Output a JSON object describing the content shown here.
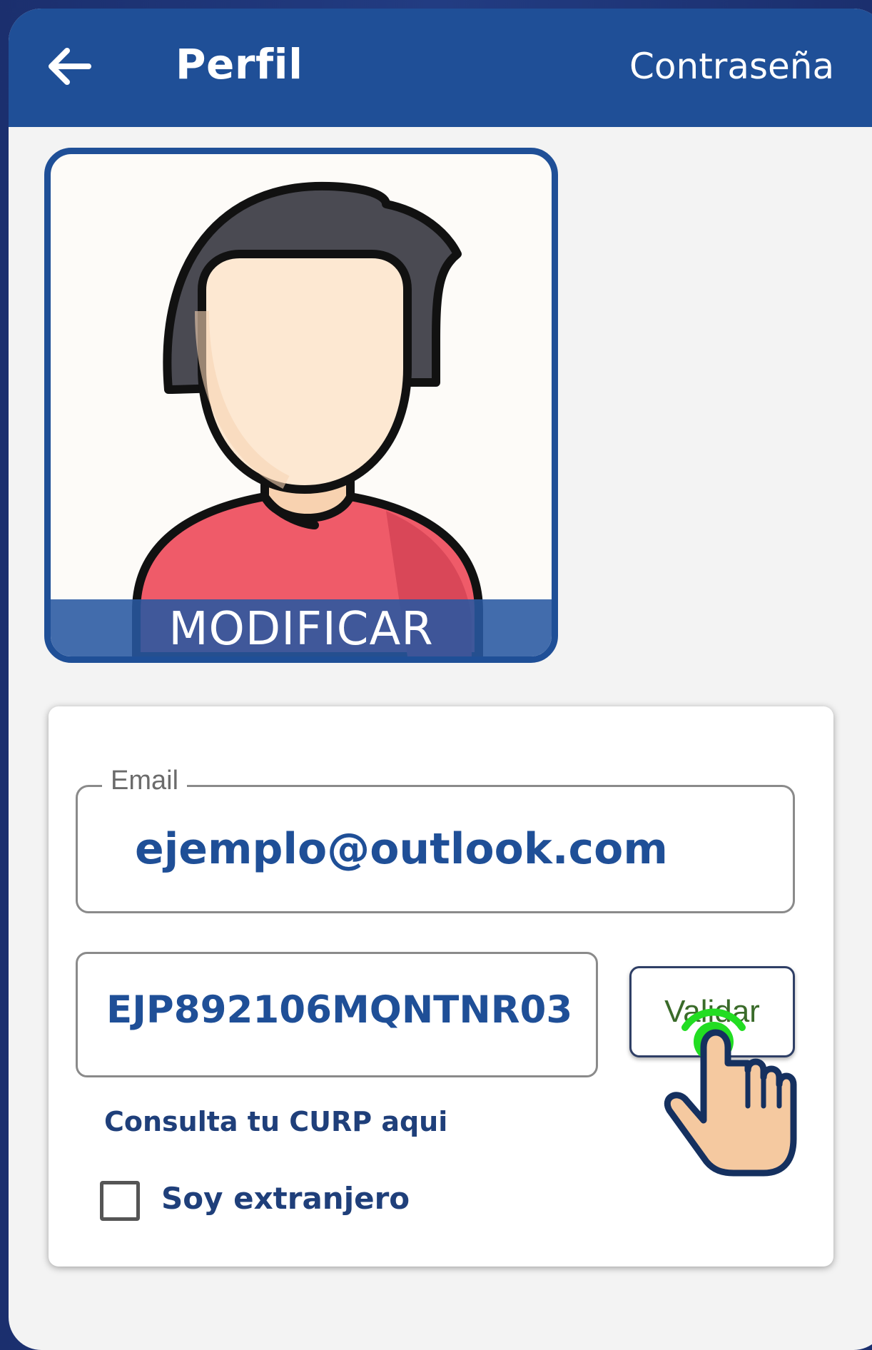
{
  "appbar": {
    "title": "Perfil",
    "password_link": "Contraseña"
  },
  "avatar": {
    "modify_label": "MODIFICAR"
  },
  "form": {
    "email": {
      "label": "Email",
      "value": "ejemplo@outlook.com"
    },
    "curp": {
      "value": "EJP892106MQNTNR03"
    },
    "validate_label": "Validar",
    "curp_link": "Consulta tu CURP aqui",
    "foreigner_label": "Soy extranjero",
    "foreigner_checked": false
  },
  "colors": {
    "primary": "#1f4f97",
    "background": "#f3f3f3",
    "tap_indicator": "#22dd22",
    "skin": "#f5c9a0"
  },
  "icons": {
    "back": "arrow-left-icon",
    "tap": "tapping-hand-icon"
  }
}
